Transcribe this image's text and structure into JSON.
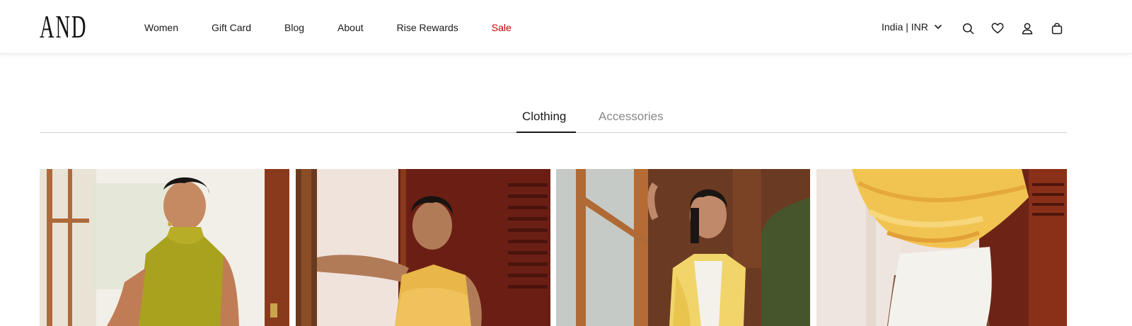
{
  "brand": {
    "logo_text": "AND"
  },
  "nav": {
    "items": [
      {
        "label": "Women"
      },
      {
        "label": "Gift Card"
      },
      {
        "label": "Blog"
      },
      {
        "label": "About"
      },
      {
        "label": "Rise Rewards"
      },
      {
        "label": "Sale",
        "color": "#c00000"
      }
    ]
  },
  "header": {
    "region_label": "India | INR",
    "icons": [
      "search-icon",
      "heart-icon",
      "user-icon",
      "bag-icon"
    ]
  },
  "tabs": [
    {
      "label": "Clothing",
      "active": true
    },
    {
      "label": "Accessories",
      "active": false
    }
  ],
  "products": [
    {
      "image": "model-olive-halter-top"
    },
    {
      "image": "model-yellow-ruffle-halter"
    },
    {
      "image": "model-yellow-tie-dye-vest"
    },
    {
      "image": "yellow-ruffle-top-white-shorts"
    }
  ],
  "colors": {
    "accent_sale": "#c00000",
    "text": "#1a1a1a",
    "muted": "#8a8a8a"
  }
}
